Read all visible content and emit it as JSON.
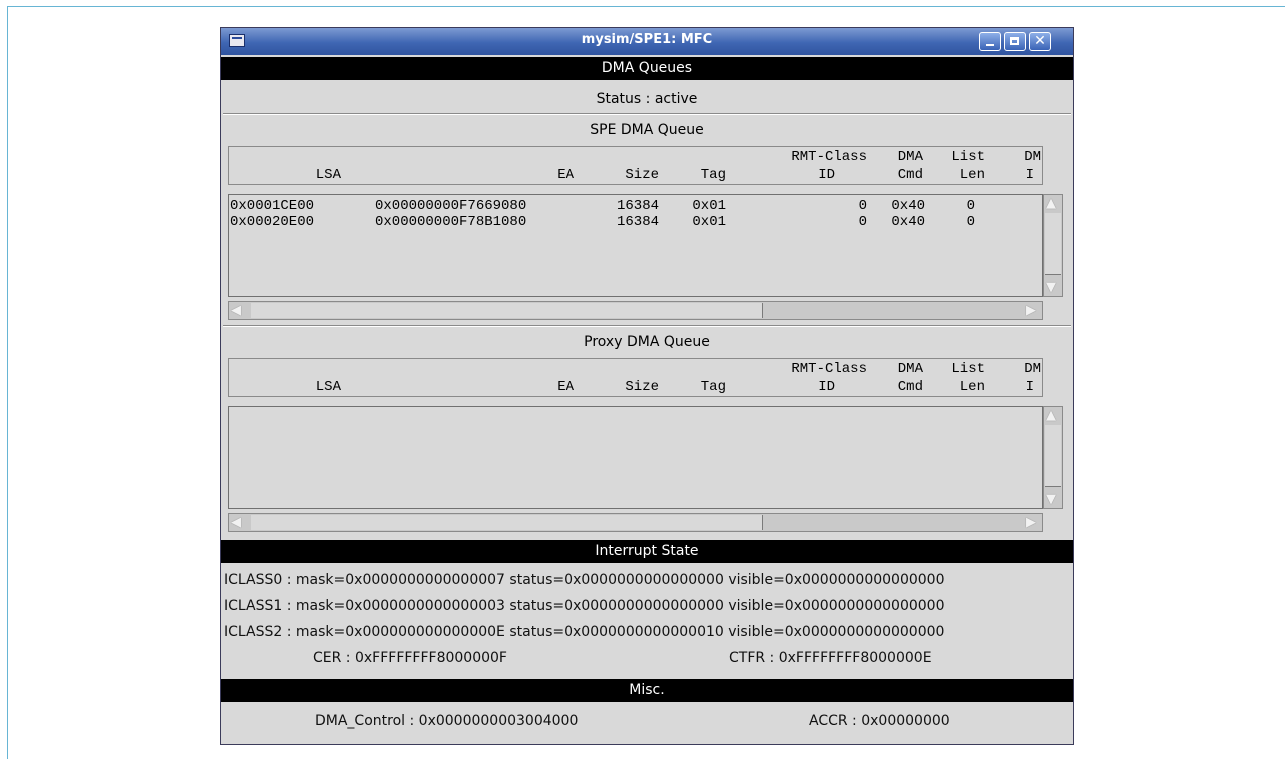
{
  "window": {
    "title": "mysim/SPE1: MFC",
    "buttons": {
      "minimize_icon": "minimize-icon",
      "maximize_icon": "maximize-icon",
      "close_icon": "close-icon",
      "close_glyph": "✕"
    }
  },
  "dma_queues": {
    "header": "DMA Queues",
    "status": "Status : active"
  },
  "columns": {
    "lsa": "LSA",
    "ea": "EA",
    "size": "Size",
    "tag": "Tag",
    "rmt_class_top": "RMT-Class",
    "rmt_class_bottom": "ID",
    "dma_top": "DMA",
    "dma_bottom": "Cmd",
    "list_top": "List",
    "list_bottom": "Len",
    "dm_top": "DM",
    "dm_bottom": "I"
  },
  "spe_queue": {
    "title": "SPE DMA Queue",
    "rows": [
      {
        "lsa": "0x0001CE00",
        "ea": "0x00000000F7669080",
        "size": "16384",
        "tag": "0x01",
        "rmt": "0",
        "cmd": "0x40",
        "len": "0"
      },
      {
        "lsa": "0x00020E00",
        "ea": "0x00000000F78B1080",
        "size": "16384",
        "tag": "0x01",
        "rmt": "0",
        "cmd": "0x40",
        "len": "0"
      }
    ]
  },
  "proxy_queue": {
    "title": "Proxy DMA Queue",
    "rows": []
  },
  "interrupt_state": {
    "header": "Interrupt State",
    "iclass": [
      "ICLASS0 : mask=0x0000000000000007 status=0x0000000000000000 visible=0x0000000000000000",
      "ICLASS1 : mask=0x0000000000000003 status=0x0000000000000000 visible=0x0000000000000000",
      "ICLASS2 : mask=0x000000000000000E status=0x0000000000000010 visible=0x0000000000000000"
    ],
    "cer": "CER : 0xFFFFFFFF8000000F",
    "ctfr": "CTFR : 0xFFFFFFFF8000000E"
  },
  "misc": {
    "header": "Misc.",
    "dma_control": "DMA_Control : 0x0000000003004000",
    "accr": "ACCR : 0x00000000"
  }
}
